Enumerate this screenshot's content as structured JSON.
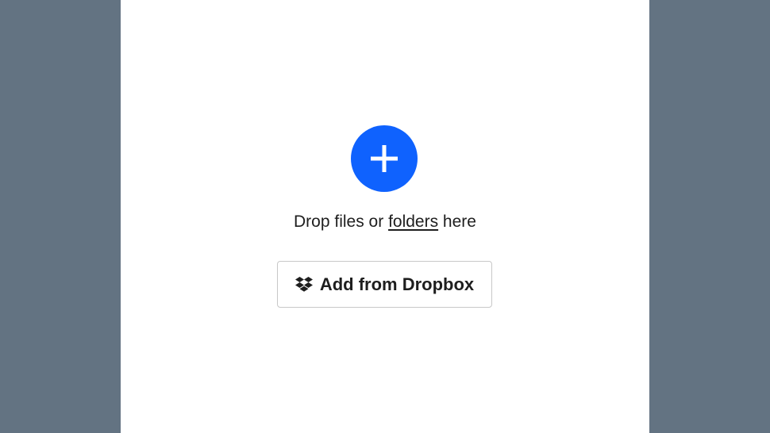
{
  "uploader": {
    "add_button_icon": "plus-icon",
    "accent_color": "#0f62fe",
    "drop_text_before": "Drop files or ",
    "drop_text_link": "folders",
    "drop_text_after": " here",
    "dropbox_button_icon": "dropbox-icon",
    "dropbox_button_label": "Add from Dropbox"
  }
}
